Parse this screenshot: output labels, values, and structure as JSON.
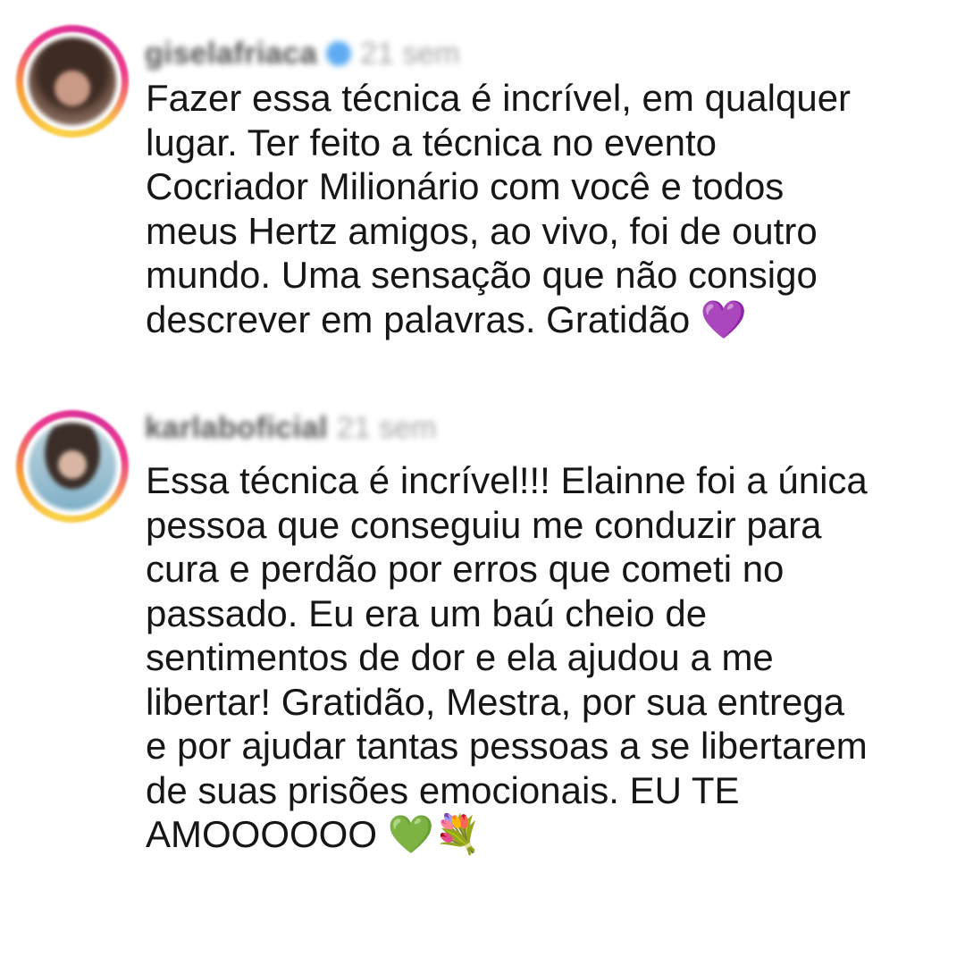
{
  "comments": [
    {
      "username": "giselafriaca",
      "time": "21 sem",
      "verified": true,
      "text": "Fazer essa técnica é incrível, em qualquer\nlugar. Ter feito a técnica no evento\nCocriador Milionário com você e todos\nmeus Hertz amigos, ao vivo, foi de outro\nmundo. Uma sensação que não consigo\ndescrever em palavras. Gratidão 💜"
    },
    {
      "username": "karlaboficial",
      "time": "21 sem",
      "verified": false,
      "text": "Essa técnica é incrível!!! Elainne foi a única\npessoa que conseguiu me conduzir para\ncura e perdão por erros que cometi no\npassado. Eu era um baú cheio de\nsentimentos de dor e ela ajudou a me\nlibertar! Gratidão, Mestra, por sua entrega\ne por ajudar tantas pessoas a se libertarem\nde suas prisões emocionais. EU TE\nAMOOOOOO 💚💐"
    }
  ],
  "colors": {
    "ring_gradient": [
      "#f9d24a",
      "#ee3d8e",
      "#d6319a"
    ],
    "verified_badge": "#3897f0",
    "text": "#161616",
    "meta": "#8e8e8e"
  }
}
